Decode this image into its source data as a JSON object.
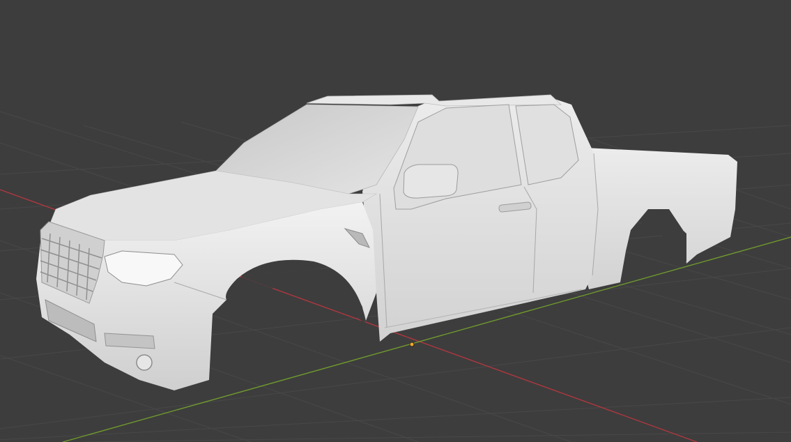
{
  "app": {
    "name": "3D viewport"
  },
  "viewport": {
    "shading": "solid",
    "background": "#3d3d3d",
    "grid_color": "#4a4a4a",
    "x_axis_color": "#b0373f",
    "y_axis_color": "#6f9a2e",
    "origin_color": "#f5a623",
    "model_color": "#d9d9d9",
    "model": "pickup-truck-body"
  }
}
